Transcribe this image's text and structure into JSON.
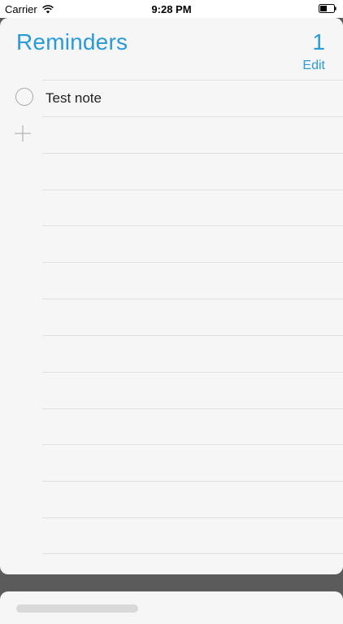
{
  "status_bar": {
    "carrier": "Carrier",
    "time": "9:28 PM",
    "wifi_icon": "wifi-icon",
    "battery_icon": "battery-icon"
  },
  "list": {
    "title": "Reminders",
    "count": "1",
    "edit_label": "Edit",
    "accent_color": "#2a9ad9",
    "items": [
      {
        "text": "Test note",
        "completed": false
      }
    ],
    "add_icon": "plus-icon"
  }
}
